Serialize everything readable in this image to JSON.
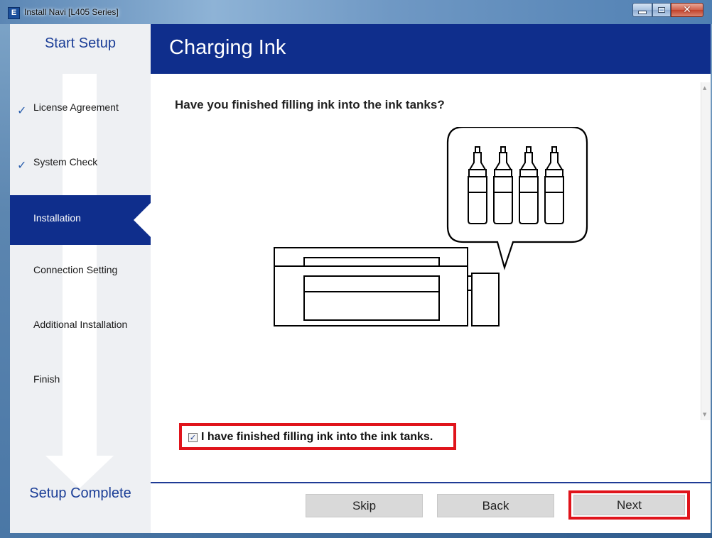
{
  "window": {
    "title": "Install Navi [L405 Series]",
    "app_icon_letter": "E"
  },
  "sidebar": {
    "start_label": "Start Setup",
    "end_label": "Setup Complete",
    "steps": [
      {
        "label": "License Agreement",
        "state": "done"
      },
      {
        "label": "System Check",
        "state": "done"
      },
      {
        "label": "Installation",
        "state": "current"
      },
      {
        "label": "Connection Setting",
        "state": "pending"
      },
      {
        "label": "Additional Installation",
        "state": "pending"
      },
      {
        "label": "Finish",
        "state": "pending"
      }
    ],
    "check_glyph": "✓"
  },
  "header": {
    "title": "Charging Ink"
  },
  "main": {
    "question": "Have you finished filling ink into the ink tanks?",
    "illustration_icon": "printer-ink-bottles-illustration",
    "confirm_checkbox": {
      "label": "I have finished filling ink into the ink tanks.",
      "checked": true,
      "glyph": "✓"
    }
  },
  "footer": {
    "skip_label": "Skip",
    "back_label": "Back",
    "next_label": "Next"
  },
  "colors": {
    "header_bg": "#0f2e8c",
    "accent_text": "#1b3e97",
    "highlight_border": "#e0141b"
  }
}
